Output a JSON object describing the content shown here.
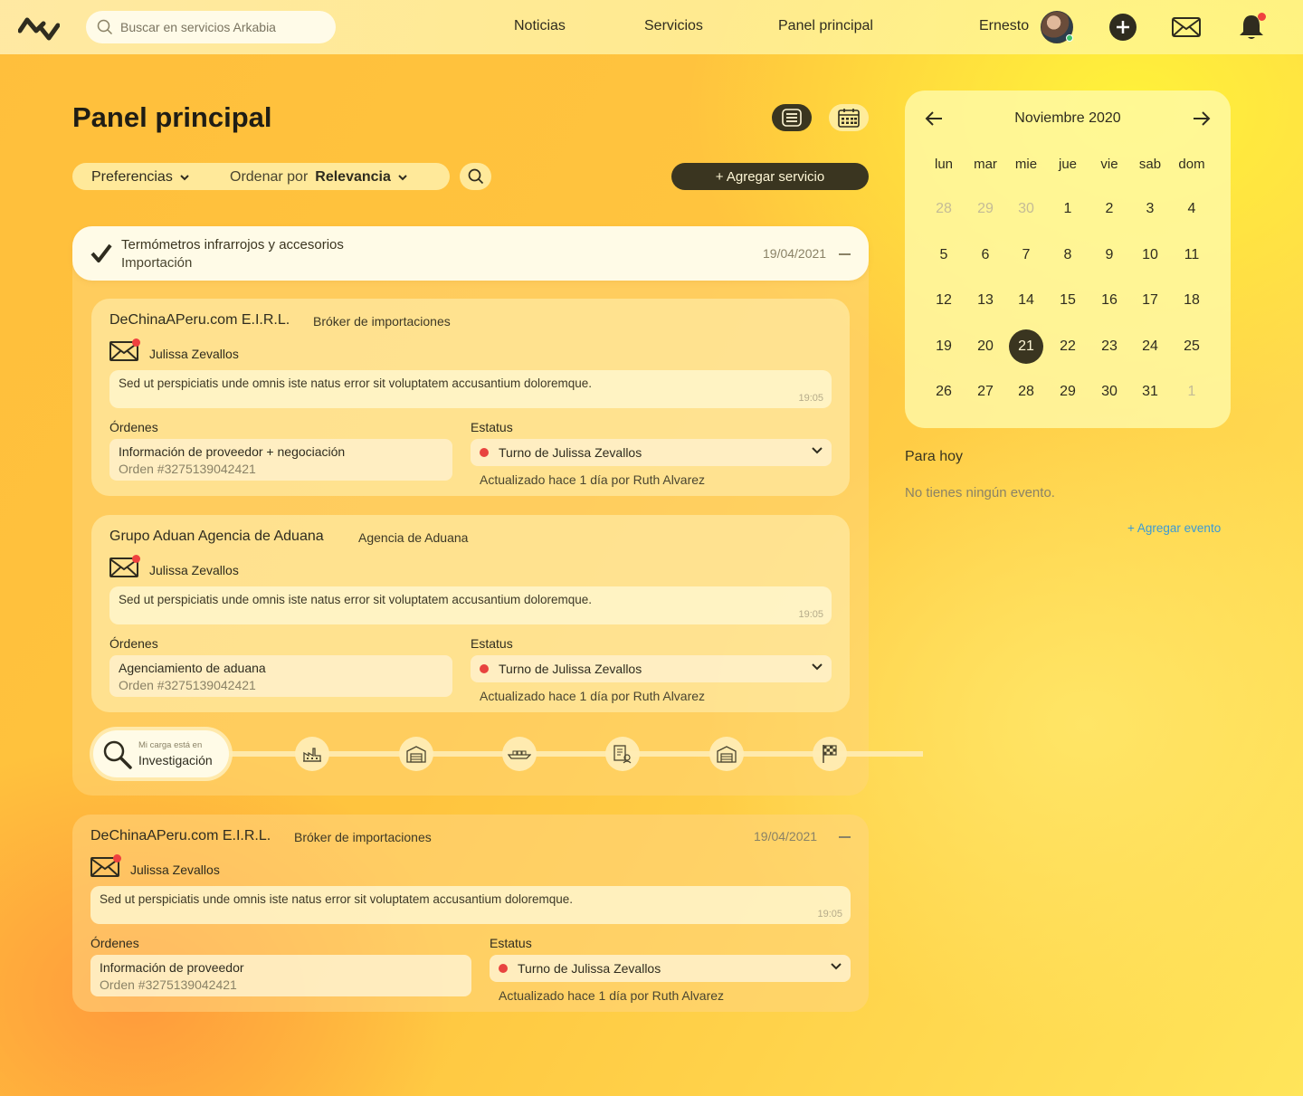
{
  "topbar": {
    "search_placeholder": "Buscar en servicios Arkabia",
    "nav": [
      "Noticias",
      "Servicios",
      "Panel principal"
    ],
    "user_name": "Ernesto"
  },
  "page": {
    "title": "Panel principal",
    "filter_preferences": "Preferencias",
    "sort_label": "Ordenar por",
    "sort_value": "Relevancia",
    "add_service": "+ Agregar servicio"
  },
  "group": {
    "title": "Termómetros infrarrojos y accesorios",
    "subtitle": "Importación",
    "date": "19/04/2021",
    "cards": [
      {
        "company": "DeChinaAPeru.com E.I.R.L.",
        "role": "Bróker de importaciones",
        "contact": "Julissa Zevallos",
        "message": "Sed ut perspiciatis unde omnis iste natus error sit voluptatem accusantium doloremque.",
        "message_time": "19:05",
        "orders_label": "Órdenes",
        "status_label": "Estatus",
        "order_name": "Información de proveedor + negociación",
        "order_number": "Orden #3275139042421",
        "status": "Turno de Julissa Zevallos",
        "updated": "Actualizado hace 1 día por Ruth Alvarez"
      },
      {
        "company": "Grupo Aduan Agencia de Aduana",
        "role": "Agencia de Aduana",
        "contact": "Julissa Zevallos",
        "message": "Sed ut perspiciatis unde omnis iste natus error sit voluptatem accusantium doloremque.",
        "message_time": "19:05",
        "orders_label": "Órdenes",
        "status_label": "Estatus",
        "order_name": "Agenciamiento de aduana",
        "order_number": "Orden #3275139042421",
        "status": "Turno de Julissa Zevallos",
        "updated": "Actualizado hace 1 día por Ruth Alvarez"
      }
    ],
    "progress": {
      "caption": "Mi carga está en",
      "stage": "Investigación",
      "stage_icons": [
        "factory-icon",
        "warehouse-icon",
        "ship-icon",
        "documents-icon",
        "warehouse-icon",
        "finish-flag-icon"
      ]
    }
  },
  "card2": {
    "company": "DeChinaAPeru.com E.I.R.L.",
    "role": "Bróker de importaciones",
    "date": "19/04/2021",
    "contact": "Julissa Zevallos",
    "message": "Sed ut perspiciatis unde omnis iste natus error sit voluptatem accusantium doloremque.",
    "message_time": "19:05",
    "orders_label": "Órdenes",
    "status_label": "Estatus",
    "order_name": "Información de proveedor",
    "order_number": "Orden #3275139042421",
    "status": "Turno de Julissa Zevallos",
    "updated": "Actualizado hace 1 día por Ruth Alvarez"
  },
  "calendar": {
    "title": "Noviembre 2020",
    "weekdays": [
      "lun",
      "mar",
      "mie",
      "jue",
      "vie",
      "sab",
      "dom"
    ],
    "weeks": [
      [
        "28",
        "29",
        "30",
        "1",
        "2",
        "3",
        "4"
      ],
      [
        "5",
        "6",
        "7",
        "8",
        "9",
        "10",
        "11"
      ],
      [
        "12",
        "13",
        "14",
        "15",
        "16",
        "17",
        "18"
      ],
      [
        "19",
        "20",
        "21",
        "22",
        "23",
        "24",
        "25"
      ],
      [
        "26",
        "27",
        "28",
        "29",
        "30",
        "31",
        "1"
      ]
    ],
    "selected": "21",
    "today_title": "Para hoy",
    "no_events": "No tienes ningún evento.",
    "add_event": "+ Agregar evento"
  },
  "colors": {
    "accent_dark": "#3a3520",
    "status_dot": "#e8433f",
    "notification": "#f0413f",
    "link": "#3a9ad6"
  }
}
